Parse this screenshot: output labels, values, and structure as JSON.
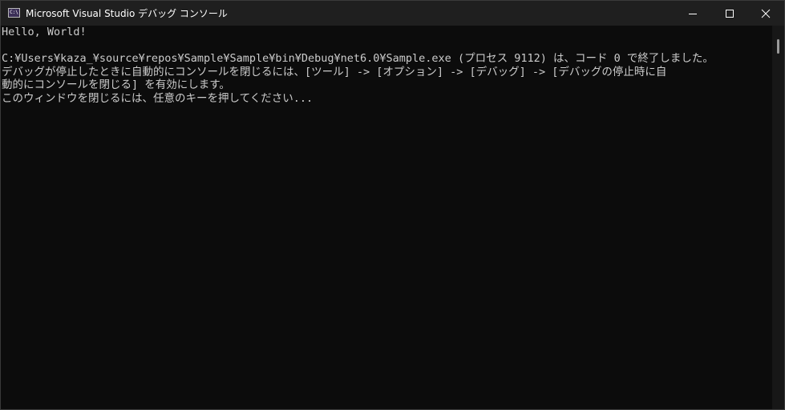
{
  "window": {
    "title": "Microsoft Visual Studio デバッグ コンソール",
    "icon": "console-app-icon",
    "icon_text": "C:\\"
  },
  "controls": {
    "minimize_icon": "minimize-icon",
    "maximize_icon": "maximize-icon",
    "close_icon": "close-icon"
  },
  "console": {
    "lines": [
      "Hello, World!",
      "",
      "C:¥Users¥kaza_¥source¥repos¥Sample¥Sample¥bin¥Debug¥net6.0¥Sample.exe (プロセス 9112) は、コード 0 で終了しました。",
      "デバッグが停止したときに自動的にコンソールを閉じるには、[ツール] -> [オプション] -> [デバッグ] -> [デバッグの停止時に自",
      "動的にコンソールを閉じる] を有効にします。",
      "このウィンドウを閉じるには、任意のキーを押してください..."
    ],
    "text_color": "#cccccc",
    "background_color": "#0c0c0c"
  }
}
